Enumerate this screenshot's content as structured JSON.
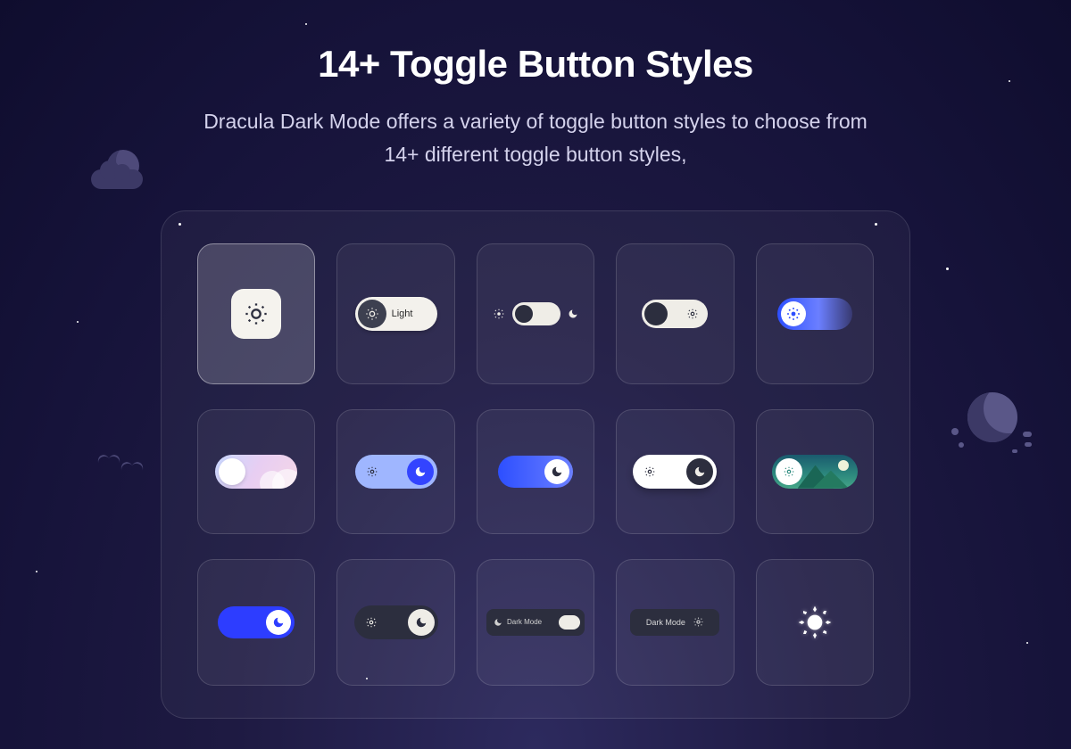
{
  "header": {
    "title": "14+ Toggle Button Styles",
    "subtitle": "Dracula Dark Mode offers a variety of toggle button styles to choose from 14+ different toggle button styles,"
  },
  "toggles": {
    "style2_label": "Light",
    "style13_label": "Dark Mode",
    "style14_label": "Dark Mode"
  },
  "icons": {
    "sun": "sun-icon",
    "moon": "moon-icon"
  },
  "colors": {
    "accent_blue": "#2d4fff",
    "cream": "#efede7",
    "dark_knob": "#2c2e3e"
  }
}
